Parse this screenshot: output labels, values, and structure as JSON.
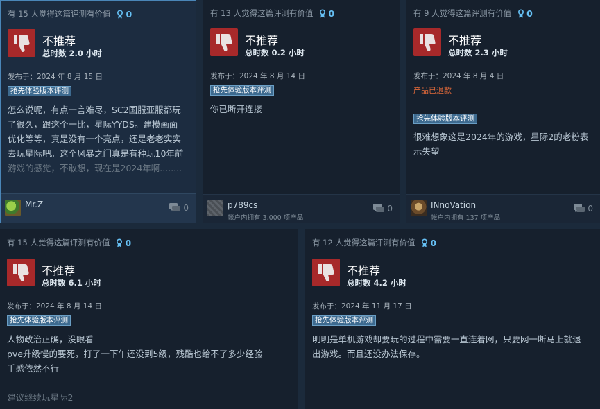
{
  "reviews": [
    {
      "helpful_text": "有 15 人觉得这篇评测有价值",
      "awards": "0",
      "verdict": "不推荐",
      "hours": "总时数 2.0 小时",
      "posted": "发布于：2024 年 8 月 15 日",
      "badge": "抢先体验版本评测",
      "body": [
        "怎么说呢，有点一言难尽，SC2国服亚服都玩",
        "了很久，跟这个一比，星际YYDS。建模画面",
        "优化等等，真是没有一个亮点，还是老老实实",
        "去玩星际吧。这个风暴之门真是有种玩10年前",
        "游戏的感觉，不敢想，现在是2024年啊........"
      ],
      "username": "Mr.Z",
      "products": "",
      "comments": "0"
    },
    {
      "helpful_text": "有 13 人觉得这篇评测有价值",
      "awards": "0",
      "verdict": "不推荐",
      "hours": "总时数 0.2 小时",
      "posted": "发布于：2024 年 8 月 14 日",
      "badge": "抢先体验版本评测",
      "body": [
        "你已断开连接"
      ],
      "username": "p789cs",
      "products": "帐户内拥有 3,000 项产品",
      "comments": "0"
    },
    {
      "helpful_text": "有 9 人觉得这篇评测有价值",
      "awards": "0",
      "verdict": "不推荐",
      "hours": "总时数 2.3 小时",
      "posted": "发布于：2024 年 8 月 4 日",
      "refunded": "产品已退款",
      "badge": "抢先体验版本评测",
      "body": [
        "很难想象这是2024年的游戏，星际2的老粉表",
        "示失望"
      ],
      "username": "INnoVation",
      "products": "帐户内拥有 137 项产品",
      "comments": "0"
    },
    {
      "helpful_text": "有 15 人觉得这篇评测有价值",
      "awards": "0",
      "verdict": "不推荐",
      "hours": "总时数 6.1 小时",
      "posted": "发布于：2024 年 8 月 14 日",
      "badge": "抢先体验版本评测",
      "body": [
        "人物政治正确，没眼看",
        "pve升级慢的要死，打了一下午还没到5级，残酷也给不了多少经验",
        "手感依然不行",
        "",
        "建议继续玩星际2"
      ]
    },
    {
      "helpful_text": "有 12 人觉得这篇评测有价值",
      "awards": "0",
      "verdict": "不推荐",
      "hours": "总时数 4.2 小时",
      "posted": "发布于：2024 年 11 月 17 日",
      "badge": "抢先体验版本评测",
      "body": [
        "明明是单机游戏却要玩的过程中需要一直连着网，只要网一断马上就退",
        "出游戏。而且还没办法保存。"
      ]
    }
  ],
  "colors": {
    "thumb_down_bg": "#a7292a",
    "award_blue": "#66c0f4",
    "refunded": "#e0693a",
    "badge_bg": "#3d6a8f"
  },
  "icons": {
    "award": "award-ribbon-icon",
    "thumb": "thumbs-down-icon",
    "comment": "comment-bubble-icon"
  }
}
